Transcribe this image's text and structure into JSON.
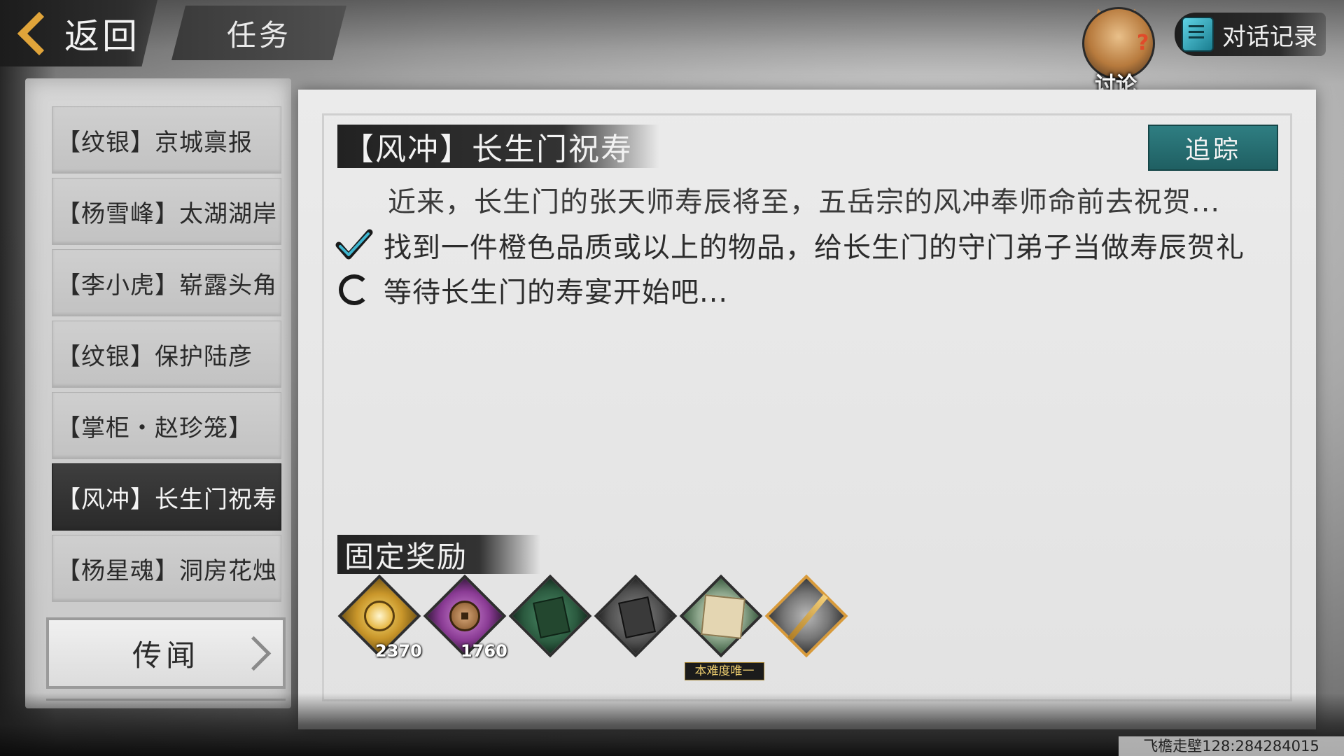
{
  "header": {
    "back_label": "返回",
    "screen_title": "任务",
    "discuss_label": "讨论",
    "dialog_log_label": "对话记录"
  },
  "quest_list": [
    {
      "label": "【纹银】京城禀报",
      "active": false
    },
    {
      "label": "【杨雪峰】太湖湖岸",
      "active": false
    },
    {
      "label": "【李小虎】崭露头角",
      "active": false
    },
    {
      "label": "【纹银】保护陆彦",
      "active": false
    },
    {
      "label": "【掌柜・赵珍笼】",
      "active": false
    },
    {
      "label": "【风冲】长生门祝寿",
      "active": true
    },
    {
      "label": "【杨星魂】洞房花烛",
      "active": false
    }
  ],
  "rumor_button": "传闻",
  "detail": {
    "title": "【风冲】长生门祝寿",
    "track_label": "追踪",
    "description": "近来，长生门的张天师寿辰将至，五岳宗的风冲奉师命前去祝贺...",
    "objectives": [
      {
        "status": "done",
        "text": "找到一件橙色品质或以上的物品，给长生门的守门弟子当做寿辰贺礼"
      },
      {
        "status": "in-progress",
        "text": "等待长生门的寿宴开始吧..."
      }
    ],
    "reward_header": "固定奖励",
    "rewards": [
      {
        "icon": "gold-coin-icon",
        "count": "2370"
      },
      {
        "icon": "copper-coin-icon",
        "count": "1760"
      },
      {
        "icon": "green-manual-icon",
        "count": ""
      },
      {
        "icon": "gray-manual-icon",
        "count": ""
      },
      {
        "icon": "sword-art-map-icon",
        "count": "",
        "tag": "本难度唯一"
      },
      {
        "icon": "sword-icon",
        "count": ""
      }
    ]
  },
  "footer_id": "飞檐走壁128:284284015",
  "colors": {
    "accent_track": "#2f7e82",
    "back_chevron": "#e0a43a"
  }
}
